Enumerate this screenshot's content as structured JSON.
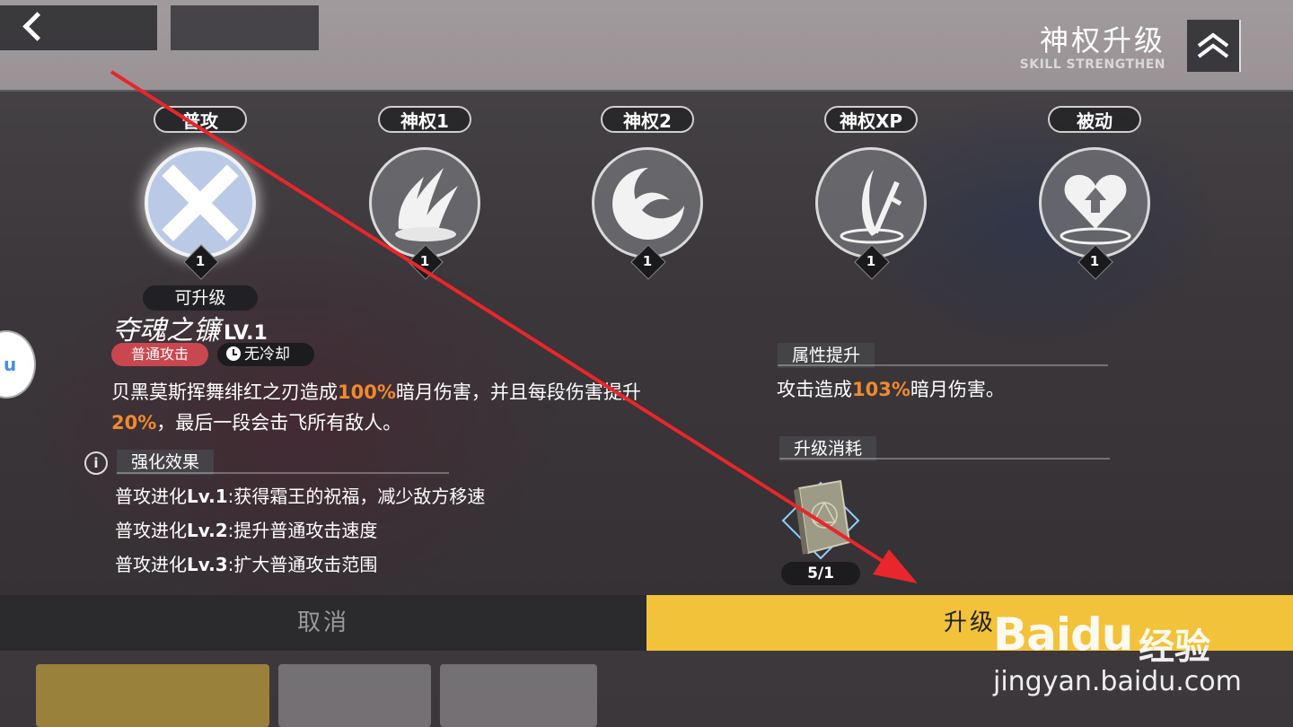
{
  "header": {
    "title": "神权升级",
    "subtitle": "SKILL STRENGTHEN"
  },
  "skills": [
    {
      "tab": "普攻",
      "level": "1",
      "status": "可升级",
      "icon": "scythe-x-icon",
      "active": true
    },
    {
      "tab": "神权1",
      "level": "1",
      "icon": "claw-slash-icon"
    },
    {
      "tab": "神权2",
      "level": "1",
      "icon": "crescent-swirl-icon"
    },
    {
      "tab": "神权XP",
      "level": "1",
      "icon": "sword-plunge-icon"
    },
    {
      "tab": "被动",
      "level": "1",
      "icon": "heart-up-icon"
    }
  ],
  "detail": {
    "name": "夺魂之镰",
    "level": "LV.1",
    "tag_type": "普通攻击",
    "tag_cooldown": "无冷却",
    "desc_1": "贝黑莫斯挥舞绯红之刃造成",
    "desc_hl1": "100%",
    "desc_2": "暗月伤害，并且每段伤害提升",
    "desc_hl2": "20%",
    "desc_3": "，最后一段会击飞所有敌人。"
  },
  "enhance": {
    "heading": "强化效果",
    "items": [
      {
        "prefix": "普攻进化",
        "lv": "Lv.1",
        "text": ":获得霜王的祝福，减少敌方移速"
      },
      {
        "prefix": "普攻进化",
        "lv": "Lv.2",
        "text": ":提升普通攻击速度"
      },
      {
        "prefix": "普攻进化",
        "lv": "Lv.3",
        "text": ":扩大普通攻击范围"
      }
    ]
  },
  "attribute": {
    "heading": "属性提升",
    "text_1": "攻击造成",
    "hl": "103%",
    "text_2": "暗月伤害。"
  },
  "cost": {
    "heading": "升级消耗",
    "count": "5/1",
    "item_icon": "skill-book-icon"
  },
  "buttons": {
    "cancel": "取消",
    "upgrade": "升级"
  },
  "watermark": {
    "brand": "Bai",
    "brand2": "du",
    "cn": "经验",
    "url": "jingyan.baidu.com"
  },
  "colors": {
    "accent": "#f2c23a",
    "highlight": "#f08a2e",
    "tag_red": "#c9474f",
    "annotation_arrow": "#e8262b"
  }
}
